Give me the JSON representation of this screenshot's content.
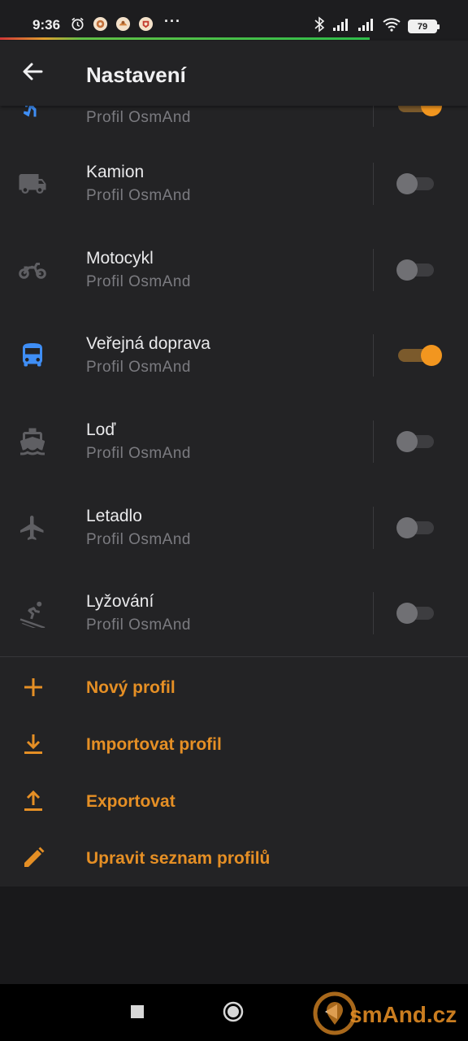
{
  "status_bar": {
    "time": "9:36",
    "battery": "79",
    "more": "···",
    "icons": [
      "alarm-icon",
      "app-icon",
      "app-icon",
      "app-icon",
      "bluetooth-icon",
      "signal-icon",
      "signal-icon",
      "wifi-icon",
      "battery-icon"
    ]
  },
  "toolbar": {
    "title": "Nastavení",
    "back_icon": "arrow-back-icon"
  },
  "profiles": [
    {
      "title": "",
      "subtitle": "Profil OsmAnd",
      "icon": "walk-icon",
      "icon_color": "#3f8ef5",
      "enabled": true
    },
    {
      "title": "Kamion",
      "subtitle": "Profil OsmAnd",
      "icon": "truck-icon",
      "icon_color": "#5f5f63",
      "enabled": false
    },
    {
      "title": "Motocykl",
      "subtitle": "Profil OsmAnd",
      "icon": "motorcycle-icon",
      "icon_color": "#5f5f63",
      "enabled": false
    },
    {
      "title": "Veřejná doprava",
      "subtitle": "Profil OsmAnd",
      "icon": "bus-icon",
      "icon_color": "#3f8ef5",
      "enabled": true
    },
    {
      "title": "Loď",
      "subtitle": "Profil OsmAnd",
      "icon": "boat-icon",
      "icon_color": "#5f5f63",
      "enabled": false
    },
    {
      "title": "Letadlo",
      "subtitle": "Profil OsmAnd",
      "icon": "airplane-icon",
      "icon_color": "#5f5f63",
      "enabled": false
    },
    {
      "title": "Lyžování",
      "subtitle": "Profil OsmAnd",
      "icon": "skiing-icon",
      "icon_color": "#5f5f63",
      "enabled": false
    }
  ],
  "actions": [
    {
      "label": "Nový profil",
      "icon": "plus-icon"
    },
    {
      "label": "Importovat profil",
      "icon": "download-icon"
    },
    {
      "label": "Exportovat",
      "icon": "upload-icon"
    },
    {
      "label": "Upravit seznam profilů",
      "icon": "pencil-icon"
    }
  ],
  "nav": {
    "watermark": "smAnd.cz"
  },
  "colors": {
    "accent": "#e58f25",
    "active_icon": "#3f8ef5",
    "inactive_icon": "#5f5f63",
    "background": "#232325"
  }
}
